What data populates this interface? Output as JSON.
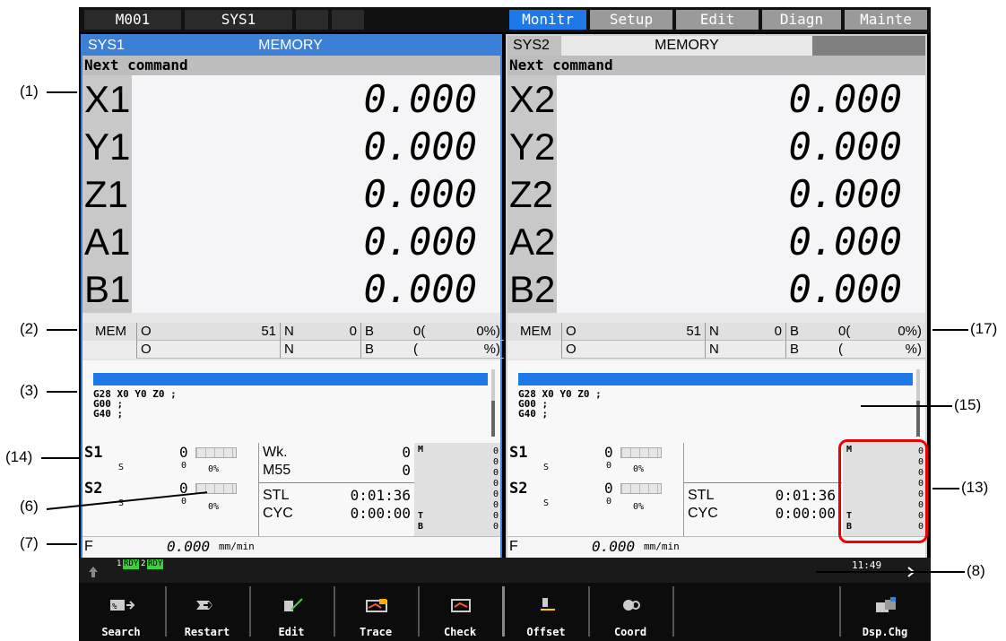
{
  "topbar": {
    "machine": "M001",
    "system": "SYS1",
    "tabs": [
      "Monitr",
      "Setup",
      "Edit",
      "Diagn",
      "Mainte"
    ]
  },
  "left": {
    "sys": "SYS1",
    "mode": "MEMORY",
    "next_command": "Next command",
    "axes": [
      {
        "name": "X1",
        "value": "0.000"
      },
      {
        "name": "Y1",
        "value": "0.000"
      },
      {
        "name": "Z1",
        "value": "0.000"
      },
      {
        "name": "A1",
        "value": "0.000"
      },
      {
        "name": "B1",
        "value": "0.000"
      }
    ],
    "mem": {
      "mode": "MEM",
      "o": "O",
      "o_val": "51",
      "n": "N",
      "n_val": "0",
      "b": "B",
      "b_val": "0(",
      "pct": "0%)",
      "o2": "O",
      "n2": "N",
      "b2": "B",
      "paren": "(",
      "pct2": "%)"
    },
    "program": [
      "G28 X0 Y0 Z0 ;",
      "G00 ;",
      "G40 ;"
    ],
    "s1": {
      "label": "S1",
      "value": "0",
      "s": "S",
      "s_val": "0",
      "pct": "0%"
    },
    "s2": {
      "label": "S2",
      "value": "0",
      "s": "S",
      "s_val": "0",
      "pct": "0%"
    },
    "wk": {
      "label": "Wk.",
      "value": "0"
    },
    "m55": {
      "label": "M55",
      "value": "0"
    },
    "stl": {
      "label": "STL",
      "value": "0:01:36"
    },
    "cyc": {
      "label": "CYC",
      "value": "0:00:00"
    },
    "m_label": "M",
    "t_label": "T",
    "b_label": "B",
    "mtb_values": [
      "0",
      "0",
      "0",
      "0",
      "0",
      "0",
      "0",
      "0"
    ],
    "feed": {
      "label": "F",
      "value": "0.000",
      "unit": "mm/min"
    }
  },
  "right": {
    "sys": "SYS2",
    "mode": "MEMORY",
    "next_command": "Next command",
    "axes": [
      {
        "name": "X2",
        "value": "0.000"
      },
      {
        "name": "Y2",
        "value": "0.000"
      },
      {
        "name": "Z2",
        "value": "0.000"
      },
      {
        "name": "A2",
        "value": "0.000"
      },
      {
        "name": "B2",
        "value": "0.000"
      }
    ],
    "mem": {
      "mode": "MEM",
      "o": "O",
      "o_val": "51",
      "n": "N",
      "n_val": "0",
      "b": "B",
      "b_val": "0(",
      "pct": "0%)",
      "o2": "O",
      "n2": "N",
      "b2": "B",
      "paren": "(",
      "pct2": "%)"
    },
    "program": [
      "G28 X0 Y0 Z0 ;",
      "G00 ;",
      "G40 ;"
    ],
    "s1": {
      "label": "S1",
      "value": "0",
      "s": "S",
      "s_val": "0",
      "pct": "0%"
    },
    "s2": {
      "label": "S2",
      "value": "0",
      "s": "S",
      "s_val": "0",
      "pct": "0%"
    },
    "stl": {
      "label": "STL",
      "value": "0:01:36"
    },
    "cyc": {
      "label": "CYC",
      "value": "0:00:00"
    },
    "m_label": "M",
    "t_label": "T",
    "b_label": "B",
    "mtb_values": [
      "0",
      "0",
      "0",
      "0",
      "0",
      "0",
      "0",
      "0"
    ],
    "feed": {
      "label": "F",
      "value": "0.000",
      "unit": "mm/min"
    }
  },
  "status": {
    "rdy1_num": "1",
    "rdy1": "RDY",
    "rdy2_num": "2",
    "rdy2": "RDY",
    "time": "11:49"
  },
  "fkeys": [
    "Search",
    "Restart",
    "Edit",
    "Trace",
    "Check",
    "Offset",
    "Coord",
    "Dsp.Chg"
  ],
  "callouts": [
    "(1)",
    "(2)",
    "(3)",
    "(14)",
    "(6)",
    "(7)",
    "(17)",
    "(15)",
    "(13)",
    "(8)"
  ]
}
